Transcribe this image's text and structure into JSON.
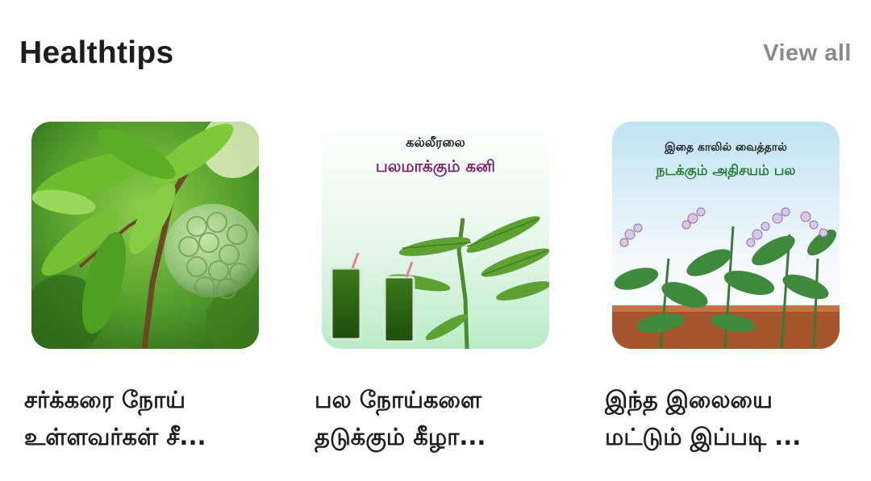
{
  "section": {
    "title": "Healthtips",
    "view_all_label": "View all"
  },
  "cards": [
    {
      "image_icon": "custard-apple-photo",
      "title_line1": "சர்க்கரை நோய்",
      "title_line2": "உள்ளவர்கள் சீ..."
    },
    {
      "image_icon": "keezhanelli-juice-photo",
      "image_text_top": "கல்லீரலை",
      "image_text_main": "பலமாக்கும் கனி",
      "title_line1": "பல நோய்களை",
      "title_line2": "தடுக்கும் கீழா..."
    },
    {
      "image_icon": "calotropis-plant-photo",
      "image_text_top": "இதை காலில் வைத்தால்",
      "image_text_main": "நடக்கும் அதிசயம் பல",
      "title_line1": "இந்த இலையை",
      "title_line2": "மட்டும் இப்படி ..."
    }
  ],
  "colors": {
    "title_text": "#1d1d1d",
    "view_all_text": "#8a8a8a",
    "image_headline_purple": "#7b1f6a",
    "image_headline_green": "#1e7d2c"
  }
}
